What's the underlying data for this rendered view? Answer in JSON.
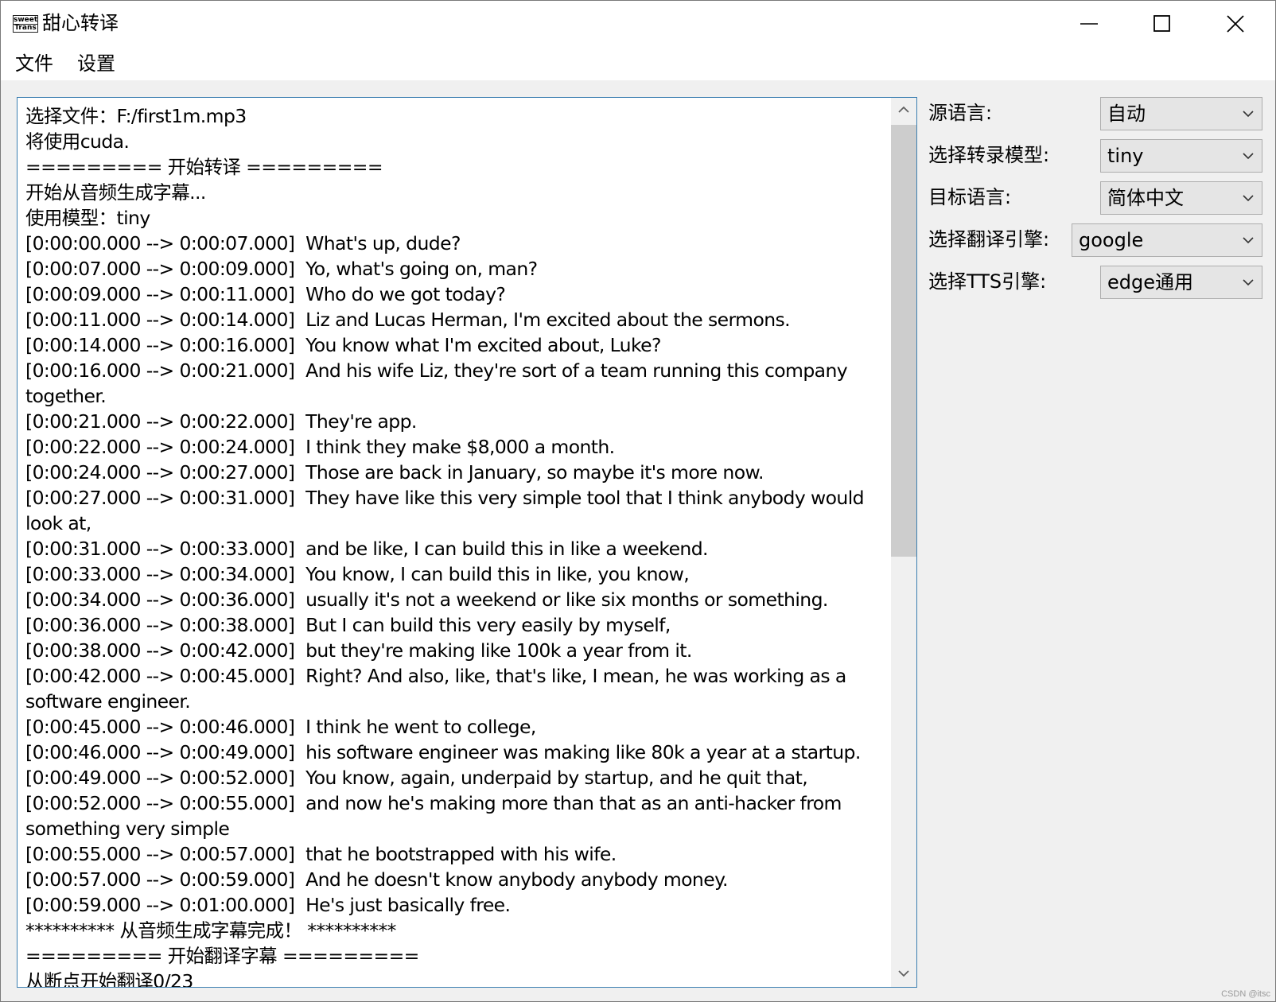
{
  "window": {
    "icon_text_top": "sweet",
    "icon_text_bottom": "Trans",
    "title": "甜心转译"
  },
  "menu": {
    "items": [
      "文件",
      "设置"
    ]
  },
  "log": {
    "text": "选择文件：F:/first1m.mp3\n将使用cuda.\n========= 开始转译 =========\n开始从音频生成字幕...\n使用模型：tiny\n[0:00:00.000 --> 0:00:07.000]  What's up, dude?\n[0:00:07.000 --> 0:00:09.000]  Yo, what's going on, man?\n[0:00:09.000 --> 0:00:11.000]  Who do we got today?\n[0:00:11.000 --> 0:00:14.000]  Liz and Lucas Herman, I'm excited about the sermons.\n[0:00:14.000 --> 0:00:16.000]  You know what I'm excited about, Luke?\n[0:00:16.000 --> 0:00:21.000]  And his wife Liz, they're sort of a team running this company together.\n[0:00:21.000 --> 0:00:22.000]  They're app.\n[0:00:22.000 --> 0:00:24.000]  I think they make $8,000 a month.\n[0:00:24.000 --> 0:00:27.000]  Those are back in January, so maybe it's more now.\n[0:00:27.000 --> 0:00:31.000]  They have like this very simple tool that I think anybody would look at,\n[0:00:31.000 --> 0:00:33.000]  and be like, I can build this in like a weekend.\n[0:00:33.000 --> 0:00:34.000]  You know, I can build this in like, you know,\n[0:00:34.000 --> 0:00:36.000]  usually it's not a weekend or like six months or something.\n[0:00:36.000 --> 0:00:38.000]  But I can build this very easily by myself,\n[0:00:38.000 --> 0:00:42.000]  but they're making like 100k a year from it.\n[0:00:42.000 --> 0:00:45.000]  Right? And also, like, that's like, I mean, he was working as a software engineer.\n[0:00:45.000 --> 0:00:46.000]  I think he went to college,\n[0:00:46.000 --> 0:00:49.000]  his software engineer was making like 80k a year at a startup.\n[0:00:49.000 --> 0:00:52.000]  You know, again, underpaid by startup, and he quit that,\n[0:00:52.000 --> 0:00:55.000]  and now he's making more than that as an anti-hacker from something very simple\n[0:00:55.000 --> 0:00:57.000]  that he bootstrapped with his wife.\n[0:00:57.000 --> 0:00:59.000]  And he doesn't know anybody anybody money.\n[0:00:59.000 --> 0:01:00.000]  He's just basically free.\n********** 从音频生成字幕完成！ **********\n========= 开始翻译字幕 =========\n从断点开始翻译0/23"
  },
  "settings": {
    "source_language": {
      "label": "源语言:",
      "value": "自动"
    },
    "model": {
      "label": "选择转录模型:",
      "value": "tiny"
    },
    "target_language": {
      "label": "目标语言:",
      "value": "简体中文"
    },
    "translate_engine": {
      "label": "选择翻译引擎:",
      "value": "google"
    },
    "tts_engine": {
      "label": "选择TTS引擎:",
      "value": "edge通用"
    }
  },
  "watermark": "CSDN @itsc"
}
